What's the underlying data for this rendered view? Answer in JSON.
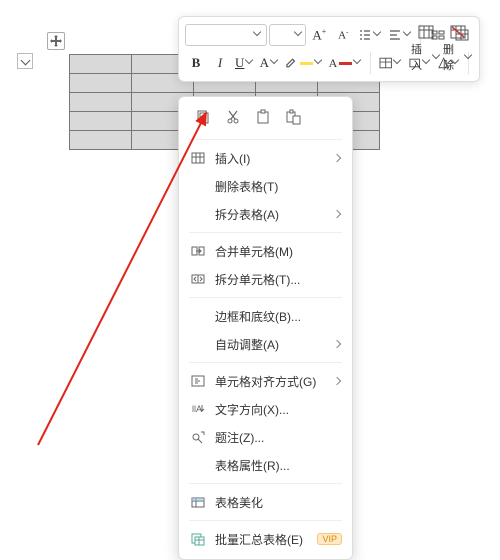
{
  "toolbar": {
    "font_name": "",
    "font_size": "",
    "increase_font": "A⁺",
    "decrease_font": "A⁻",
    "bold": "B",
    "italic": "I",
    "underline": "U",
    "strike": "A",
    "highlight_color": "#ffe04a",
    "font_color": "#d0312d",
    "insert_label": "插入",
    "delete_label": "删除"
  },
  "context_menu": {
    "top_icons": [
      "copy",
      "cut",
      "paste",
      "paste-special"
    ],
    "items": [
      {
        "icon": "table",
        "label": "插入(I)",
        "submenu": true
      },
      {
        "icon": "",
        "label": "删除表格(T)",
        "submenu": false
      },
      {
        "icon": "",
        "label": "拆分表格(A)",
        "submenu": true
      },
      {
        "icon": "merge",
        "label": "合并单元格(M)",
        "submenu": false
      },
      {
        "icon": "split",
        "label": "拆分单元格(T)...",
        "submenu": false
      },
      {
        "icon": "",
        "label": "边框和底纹(B)...",
        "submenu": false
      },
      {
        "icon": "",
        "label": "自动调整(A)",
        "submenu": true
      },
      {
        "icon": "align",
        "label": "单元格对齐方式(G)",
        "submenu": true
      },
      {
        "icon": "textdir",
        "label": "文字方向(X)...",
        "submenu": false
      },
      {
        "icon": "comment",
        "label": "题注(Z)...",
        "submenu": false
      },
      {
        "icon": "",
        "label": "表格属性(R)...",
        "submenu": false
      },
      {
        "icon": "beautify",
        "label": "表格美化",
        "submenu": false
      },
      {
        "icon": "summary",
        "label": "批量汇总表格(E)",
        "submenu": false,
        "vip": "VIP"
      }
    ]
  },
  "table": {
    "rows": 5,
    "cols": 5
  }
}
